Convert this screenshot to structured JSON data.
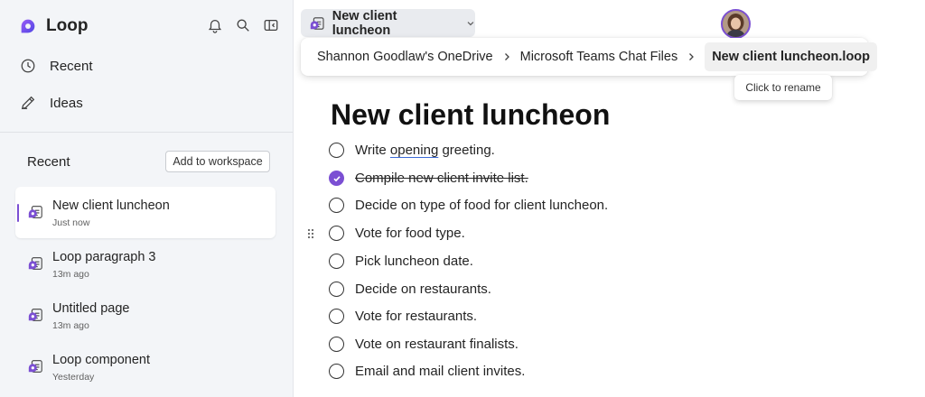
{
  "app": {
    "name": "Loop",
    "brand_color": "#7b4fd3"
  },
  "sidebar": {
    "top_icons": [
      "bell-icon",
      "search-icon",
      "collapse-sidebar-icon"
    ],
    "nav": [
      {
        "label": "Recent",
        "icon": "clock-icon"
      },
      {
        "label": "Ideas",
        "icon": "pen-icon"
      }
    ],
    "recent_heading": "Recent",
    "add_to_workspace": "Add to workspace",
    "recent_items": [
      {
        "title": "New client luncheon",
        "time": "Just now",
        "active": true
      },
      {
        "title": "Loop paragraph 3",
        "time": "13m ago"
      },
      {
        "title": "Untitled page",
        "time": "13m ago"
      },
      {
        "title": "Loop component",
        "time": "Yesterday"
      }
    ]
  },
  "header": {
    "page_title": "New client luncheon",
    "breadcrumb": [
      "Shannon Goodlaw's OneDrive",
      "Microsoft Teams Chat Files",
      "New client luncheon.loop"
    ],
    "tooltip": "Click to rename"
  },
  "document": {
    "title": "New client luncheon",
    "tasks": [
      {
        "before": "Write ",
        "spell": "opening",
        "after": " greeting.",
        "done": false
      },
      {
        "text": "Compile new client invite list.",
        "done": true
      },
      {
        "text": "Decide on type of food for client luncheon.",
        "done": false
      },
      {
        "text": "Vote for food type.",
        "done": false
      },
      {
        "text": "Pick luncheon date.",
        "done": false
      },
      {
        "text": "Decide on restaurants.",
        "done": false
      },
      {
        "text": "Vote for restaurants.",
        "done": false
      },
      {
        "text": "Vote on restaurant finalists.",
        "done": false
      },
      {
        "text": "Email and mail client invites.",
        "done": false
      }
    ]
  }
}
